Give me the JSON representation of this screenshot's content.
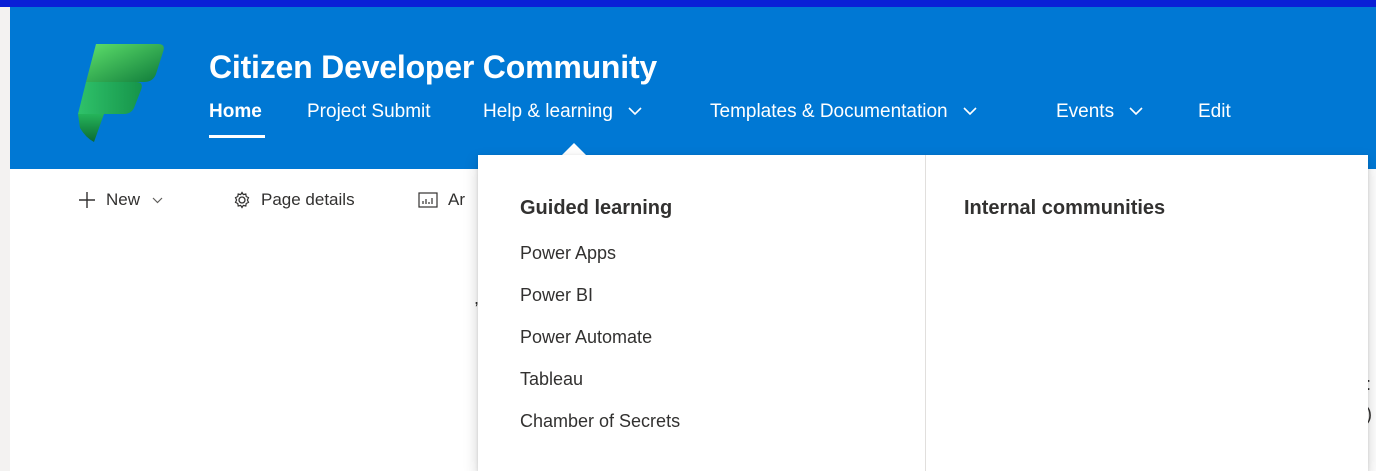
{
  "site": {
    "title": "Citizen Developer Community",
    "logo_icon": "power-platform-logo-icon"
  },
  "nav": {
    "items": [
      {
        "label": "Home",
        "active": true
      },
      {
        "label": "Project Submit"
      },
      {
        "label": "Help & learning",
        "has_dropdown": true
      },
      {
        "label": "Templates & Documentation",
        "has_dropdown": true
      },
      {
        "label": "Events",
        "has_dropdown": true
      },
      {
        "label": "Edit"
      }
    ]
  },
  "command_bar": {
    "new_label": "New",
    "page_details_label": "Page details",
    "analytics_label_partial": "Ar"
  },
  "flyout": {
    "guided_learning": {
      "heading": "Guided learning",
      "links": [
        "Power Apps",
        "Power BI",
        "Power Automate",
        "Tableau",
        "Chamber of Secrets"
      ]
    },
    "internal_communities": {
      "heading": "Internal communities"
    }
  },
  "colors": {
    "header_bg": "#0078d4",
    "top_strip": "#0a1fd6",
    "text": "#323130",
    "header_text": "#ffffff"
  }
}
